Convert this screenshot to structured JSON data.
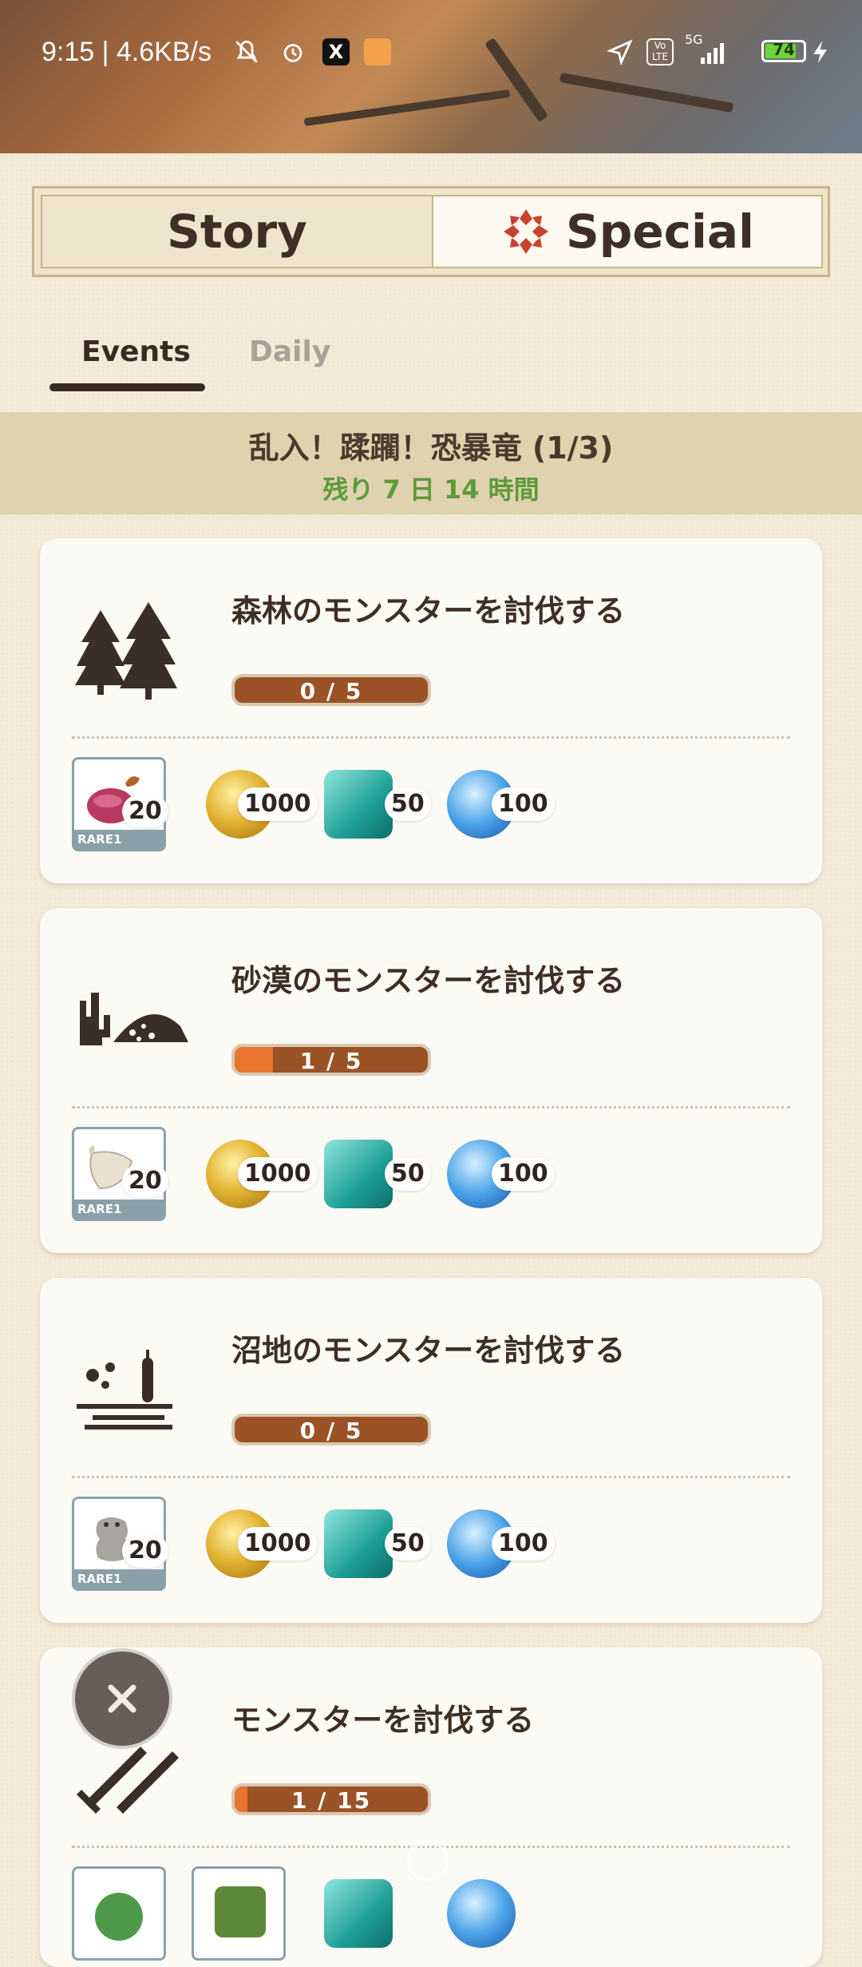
{
  "status_bar": {
    "time": "9:15 | 4.6KB/s",
    "battery": "74",
    "network": "5G"
  },
  "segment": {
    "story_label": "Story",
    "special_label": "Special"
  },
  "tabs": {
    "events": "Events",
    "daily": "Daily"
  },
  "event": {
    "title": "乱入！蹂躙！恐暴竜 (1/3)",
    "remaining": "残り 7 日 14 時間"
  },
  "missions": [
    {
      "title": "森林のモンスターを討伐する",
      "progress_text": "0 / 5",
      "progress": 0.0,
      "item_qty": "20",
      "item_rarity": "RARE1",
      "gold": "1000",
      "gem": "50",
      "blue": "100"
    },
    {
      "title": "砂漠のモンスターを討伐する",
      "progress_text": "1 / 5",
      "progress": 0.2,
      "item_qty": "20",
      "item_rarity": "RARE1",
      "gold": "1000",
      "gem": "50",
      "blue": "100"
    },
    {
      "title": "沼地のモンスターを討伐する",
      "progress_text": "0 / 5",
      "progress": 0.0,
      "item_qty": "20",
      "item_rarity": "RARE1",
      "gold": "1000",
      "gem": "50",
      "blue": "100"
    },
    {
      "title": "モンスターを討伐する",
      "progress_text": "1 / 15",
      "progress": 0.0667
    }
  ],
  "colors": {
    "background": "#f4ead8",
    "progress_track": "#9a5226",
    "progress_fill": "#e8742e",
    "remaining_text": "#5c9a3a",
    "special_icon": "#c8432f"
  },
  "icons": {
    "close": "close-icon",
    "special": "special-emblem-icon"
  }
}
